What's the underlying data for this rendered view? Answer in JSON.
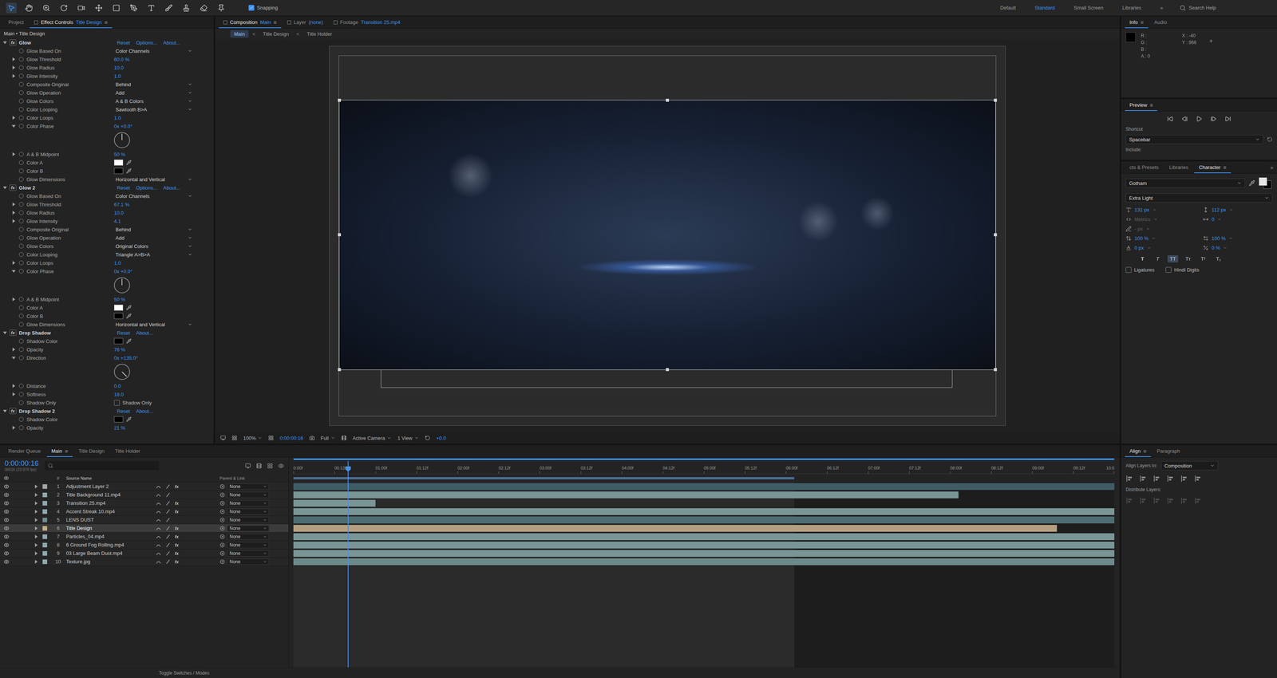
{
  "toolbar": {
    "snapping": {
      "label": "Snapping",
      "checked": true
    },
    "workspaces": [
      {
        "label": "Default",
        "selected": false
      },
      {
        "label": "Standard",
        "selected": true
      },
      {
        "label": "Small Screen",
        "selected": false
      },
      {
        "label": "Libraries",
        "selected": false
      }
    ],
    "overflow": "»",
    "search": {
      "placeholder": "Search Help"
    }
  },
  "effect_controls": {
    "tabs": [
      {
        "label": "Project",
        "layer": "",
        "selected": false
      },
      {
        "label": "Effect Controls",
        "layer": "Title Design",
        "selected": true
      }
    ],
    "menu": "≡",
    "breadcrumb": "Main • Title Design",
    "fx_label": "fx",
    "effects": [
      {
        "name": "Glow",
        "expanded": true,
        "links": [
          "Reset",
          "Options...",
          "About..."
        ],
        "properties": [
          {
            "name": "Glow Based On",
            "kind": "dropdown",
            "value": "Color Channels",
            "twirl": "none"
          },
          {
            "name": "Glow Threshold",
            "kind": "number",
            "value": "60.0 %",
            "twirl": "collapsed"
          },
          {
            "name": "Glow Radius",
            "kind": "number",
            "value": "10.0",
            "twirl": "collapsed"
          },
          {
            "name": "Glow Intensity",
            "kind": "number",
            "value": "1.0",
            "twirl": "collapsed"
          },
          {
            "name": "Composite Original",
            "kind": "dropdown",
            "value": "Behind",
            "twirl": "none"
          },
          {
            "name": "Glow Operation",
            "kind": "dropdown",
            "value": "Add",
            "twirl": "none"
          },
          {
            "name": "Glow Colors",
            "kind": "dropdown",
            "value": "A & B Colors",
            "twirl": "none"
          },
          {
            "name": "Color Looping",
            "kind": "dropdown",
            "value": "Sawtooth B>A",
            "twirl": "none"
          },
          {
            "name": "Color Loops",
            "kind": "number",
            "value": "1.0",
            "twirl": "collapsed"
          },
          {
            "name": "Color Phase",
            "kind": "angle",
            "value": "0x +0.0°",
            "twirl": "expanded",
            "dial_deg": 0
          },
          {
            "name": "A & B Midpoint",
            "kind": "number",
            "value": "50 %",
            "twirl": "collapsed"
          },
          {
            "name": "Color A",
            "kind": "color",
            "color": "#ffffff",
            "twirl": "none"
          },
          {
            "name": "Color B",
            "kind": "color",
            "color": "#000000",
            "twirl": "none"
          },
          {
            "name": "Glow Dimensions",
            "kind": "dropdown",
            "value": "Horizontal and Vertical",
            "twirl": "none"
          }
        ]
      },
      {
        "name": "Glow 2",
        "expanded": true,
        "links": [
          "Reset",
          "Options...",
          "About..."
        ],
        "properties": [
          {
            "name": "Glow Based On",
            "kind": "dropdown",
            "value": "Color Channels",
            "twirl": "none"
          },
          {
            "name": "Glow Threshold",
            "kind": "number",
            "value": "67.1 %",
            "twirl": "collapsed"
          },
          {
            "name": "Glow Radius",
            "kind": "number",
            "value": "10.0",
            "twirl": "collapsed"
          },
          {
            "name": "Glow Intensity",
            "kind": "number",
            "value": "4.1",
            "twirl": "collapsed"
          },
          {
            "name": "Composite Original",
            "kind": "dropdown",
            "value": "Behind",
            "twirl": "none"
          },
          {
            "name": "Glow Operation",
            "kind": "dropdown",
            "value": "Add",
            "twirl": "none"
          },
          {
            "name": "Glow Colors",
            "kind": "dropdown",
            "value": "Original Colors",
            "twirl": "none"
          },
          {
            "name": "Color Looping",
            "kind": "dropdown",
            "value": "Triangle A>B>A",
            "twirl": "none"
          },
          {
            "name": "Color Loops",
            "kind": "number",
            "value": "1.0",
            "twirl": "collapsed"
          },
          {
            "name": "Color Phase",
            "kind": "angle",
            "value": "0x +0.0°",
            "twirl": "expanded",
            "dial_deg": 0
          },
          {
            "name": "A & B Midpoint",
            "kind": "number",
            "value": "50 %",
            "twirl": "collapsed"
          },
          {
            "name": "Color A",
            "kind": "color",
            "color": "#ffffff",
            "twirl": "none"
          },
          {
            "name": "Color B",
            "kind": "color",
            "color": "#000000",
            "twirl": "none"
          },
          {
            "name": "Glow Dimensions",
            "kind": "dropdown",
            "value": "Horizontal and Vertical",
            "twirl": "none"
          }
        ]
      },
      {
        "name": "Drop Shadow",
        "expanded": true,
        "links": [
          "Reset",
          "About..."
        ],
        "properties": [
          {
            "name": "Shadow Color",
            "kind": "color",
            "color": "#000000",
            "twirl": "none"
          },
          {
            "name": "Opacity",
            "kind": "number",
            "value": "76 %",
            "twirl": "collapsed"
          },
          {
            "name": "Direction",
            "kind": "angle",
            "value": "0x +135.0°",
            "twirl": "expanded",
            "dial_deg": 135
          },
          {
            "name": "Distance",
            "kind": "number",
            "value": "0.0",
            "twirl": "collapsed"
          },
          {
            "name": "Softness",
            "kind": "number",
            "value": "18.0",
            "twirl": "collapsed"
          },
          {
            "name": "Shadow Only",
            "kind": "checkbox",
            "checkbox_label": "Shadow Only",
            "checked": false,
            "twirl": "none"
          }
        ]
      },
      {
        "name": "Drop Shadow 2",
        "expanded": true,
        "links": [
          "Reset",
          "About..."
        ],
        "properties": [
          {
            "name": "Shadow Color",
            "kind": "color",
            "color": "#000000",
            "twirl": "none"
          },
          {
            "name": "Opacity",
            "kind": "number",
            "value": "21 %",
            "twirl": "collapsed"
          }
        ]
      }
    ]
  },
  "composition": {
    "tabs": [
      {
        "label": "Composition",
        "name": "Main",
        "selected": true
      },
      {
        "label": "Layer",
        "name": "(none)",
        "selected": false
      },
      {
        "label": "Footage",
        "name": "Transition 25.mp4",
        "selected": false
      }
    ],
    "menu": "≡",
    "breadcrumbs": [
      {
        "label": "Main",
        "selected": true
      },
      {
        "label": "Title Design",
        "selected": false
      },
      {
        "label": "Title Holder",
        "selected": false
      }
    ],
    "separator": "<",
    "footer": {
      "zoom": "100%",
      "timecode": "0:00:00:16",
      "resolution": "Full",
      "camera": "Active Camera",
      "views": "1 View",
      "exposure": "+0.0"
    }
  },
  "info": {
    "tabs": [
      {
        "label": "Info",
        "selected": true
      },
      {
        "label": "Audio",
        "selected": false
      }
    ],
    "menu": "≡",
    "swatch": "#000000",
    "channels": [
      "R :",
      "G :",
      "B :",
      "A : 0"
    ],
    "coords": [
      "X : -40",
      "Y : 966"
    ],
    "crosshair": "+"
  },
  "preview": {
    "title": "Preview",
    "menu": "≡",
    "shortcut_label": "Shortcut",
    "shortcut": "Spacebar",
    "include_label": "Include:"
  },
  "character": {
    "tabs": [
      {
        "label": "cts & Presets",
        "selected": false
      },
      {
        "label": "Libraries",
        "selected": false
      },
      {
        "label": "Character",
        "selected": true
      }
    ],
    "menu": "≡",
    "overflow": "»",
    "font": "Gotham",
    "style": "Extra Light",
    "fill_color": "#e6e6e6",
    "stroke_color": "#000000",
    "rows": [
      [
        {
          "value": "131 px",
          "disabled": false
        },
        {
          "value": "112 px",
          "disabled": false
        }
      ],
      [
        {
          "value": "Metrics",
          "disabled": true
        },
        {
          "value": "0",
          "disabled": false
        }
      ],
      [
        {
          "value": "- px",
          "disabled": true
        }
      ],
      [
        {
          "value": "100 %",
          "disabled": false
        },
        {
          "value": "100 %",
          "disabled": false
        }
      ],
      [
        {
          "value": "0 px",
          "disabled": false
        },
        {
          "value": "0 %",
          "disabled": false
        }
      ]
    ],
    "style_buttons": [
      {
        "label": "T",
        "kind": "bold",
        "selected": false
      },
      {
        "label": "T",
        "kind": "italic",
        "selected": false
      },
      {
        "label": "TT",
        "kind": "caps",
        "selected": true
      },
      {
        "label": "Tт",
        "kind": "smallcaps",
        "selected": false
      },
      {
        "label": "T¹",
        "kind": "super",
        "selected": false
      },
      {
        "label": "T₁",
        "kind": "sub",
        "selected": false
      }
    ],
    "checkboxes": [
      {
        "label": "Ligatures",
        "checked": false
      },
      {
        "label": "Hindi Digits",
        "checked": false
      }
    ]
  },
  "timeline": {
    "tabs": [
      {
        "label": "Render Queue",
        "selected": false
      },
      {
        "label": "Main",
        "selected": true
      },
      {
        "label": "Title Design",
        "selected": false
      },
      {
        "label": "Title Holder",
        "selected": false
      }
    ],
    "menu": "≡",
    "timecode": "0:00:00:16",
    "frame_info": "00016 (23.976 fps)",
    "columns": {
      "index": "#",
      "name": "Source Name",
      "parent": "Parent & Link"
    },
    "fx_label": "fx",
    "duration_s": 10,
    "playhead_s": 0.667,
    "work_area_end_s": 6.1,
    "ruler": {
      "step_s": 0.5,
      "labels": [
        "0:00f",
        "00:12f",
        "01:00f",
        "01:12f",
        "02:00f",
        "02:12f",
        "03:00f",
        "03:12f",
        "04:00f",
        "04:12f",
        "05:00f",
        "05:12f",
        "06:00f",
        "06:12f",
        "07:00f",
        "07:12f",
        "08:00f",
        "08:12f",
        "09:00f",
        "09:12f",
        "10:0"
      ]
    },
    "layers": [
      {
        "index": "1",
        "name": "Adjustment Layer 2",
        "selected": false,
        "visible": true,
        "fx": true,
        "color": "#a4a4a4",
        "bar_color": "#3f5c66",
        "in_s": 0,
        "out_s": 10,
        "parent": "None"
      },
      {
        "index": "2",
        "name": "Title Background 11.mp4",
        "selected": false,
        "visible": true,
        "fx": false,
        "color": "#8fa9ab",
        "bar_color": "#7a9596",
        "in_s": 0,
        "out_s": 8.1,
        "parent": "None"
      },
      {
        "index": "3",
        "name": "Transition 25.mp4",
        "selected": false,
        "visible": true,
        "fx": true,
        "color": "#8fa9ab",
        "bar_color": "#7a9596",
        "in_s": 0,
        "out_s": 1.0,
        "parent": "None"
      },
      {
        "index": "4",
        "name": "Accent Streak 10.mp4",
        "selected": false,
        "visible": true,
        "fx": true,
        "color": "#8fa9ab",
        "bar_color": "#7a9596",
        "in_s": 0,
        "out_s": 10,
        "parent": "None"
      },
      {
        "index": "5",
        "name": "LENS DUST",
        "selected": false,
        "visible": true,
        "fx": false,
        "color": "#6f8d8f",
        "bar_color": "#4e6d70",
        "in_s": 0,
        "out_s": 10,
        "parent": "None"
      },
      {
        "index": "6",
        "name": "Title Design",
        "selected": true,
        "visible": true,
        "fx": true,
        "color": "#c2ad8a",
        "bar_color": "#b49f80",
        "in_s": 0,
        "out_s": 9.3,
        "parent": "None"
      },
      {
        "index": "7",
        "name": "Particles_04.mp4",
        "selected": false,
        "visible": true,
        "fx": true,
        "color": "#8fa9ab",
        "bar_color": "#7a9596",
        "in_s": 0,
        "out_s": 10,
        "parent": "None"
      },
      {
        "index": "8",
        "name": "6 Ground Fog Rolling.mp4",
        "selected": false,
        "visible": true,
        "fx": true,
        "color": "#8fa9ab",
        "bar_color": "#7a9596",
        "in_s": 0,
        "out_s": 10,
        "parent": "None"
      },
      {
        "index": "9",
        "name": "03 Large Beam Dust.mp4",
        "selected": false,
        "visible": true,
        "fx": true,
        "color": "#8fa9ab",
        "bar_color": "#7a9596",
        "in_s": 0,
        "out_s": 10,
        "parent": "None"
      },
      {
        "index": "10",
        "name": "Texture.jpg",
        "selected": false,
        "visible": true,
        "fx": true,
        "color": "#8fa9ab",
        "bar_color": "#6d8a8b",
        "in_s": 0,
        "out_s": 10,
        "parent": "None"
      }
    ],
    "footer": "Toggle Switches / Modes"
  },
  "align": {
    "tabs": [
      {
        "label": "Align",
        "selected": true
      },
      {
        "label": "Paragraph",
        "selected": false
      }
    ],
    "menu": "≡",
    "align_to_label": "Align Layers to:",
    "align_to": "Composition",
    "distribute_label": "Distribute Layers:"
  }
}
